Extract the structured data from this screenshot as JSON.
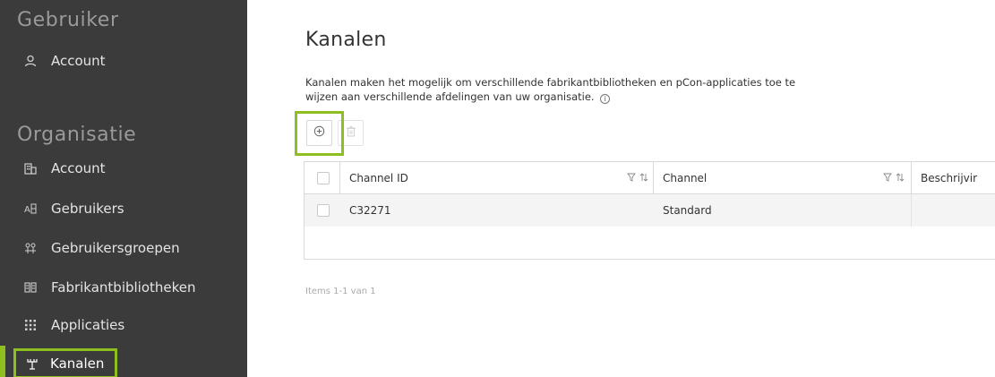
{
  "sidebar": {
    "section_user": "Gebruiker",
    "user_items": [
      {
        "label": "Account",
        "icon": "person-icon"
      }
    ],
    "section_org": "Organisatie",
    "org_items": [
      {
        "label": "Account",
        "icon": "building-icon"
      },
      {
        "label": "Gebruikers",
        "icon": "users-grid-icon"
      },
      {
        "label": "Gebruikersgroepen",
        "icon": "user-groups-icon"
      },
      {
        "label": "Fabrikantbibliotheken",
        "icon": "library-icon"
      },
      {
        "label": "Applicaties",
        "icon": "apps-grid-icon"
      },
      {
        "label": "Kanalen",
        "icon": "channels-icon",
        "active": true
      }
    ],
    "accent_color": "#8dbf1f"
  },
  "main": {
    "title": "Kanalen",
    "description_line1": "Kanalen maken het mogelijk om verschillende fabrikantbibliotheken en pCon-applicaties toe te",
    "description_line2": "wijzen aan verschillende afdelingen van uw organisatie.",
    "toolbar": {
      "add_icon": "add-circle-icon",
      "delete_icon": "trash-icon"
    },
    "table": {
      "columns": [
        "Channel ID",
        "Channel",
        "Beschrijvir"
      ],
      "rows": [
        {
          "channel_id": "C32271",
          "channel": "Standard",
          "description": ""
        }
      ]
    },
    "pagination_text": "Items 1-1 van 1"
  }
}
